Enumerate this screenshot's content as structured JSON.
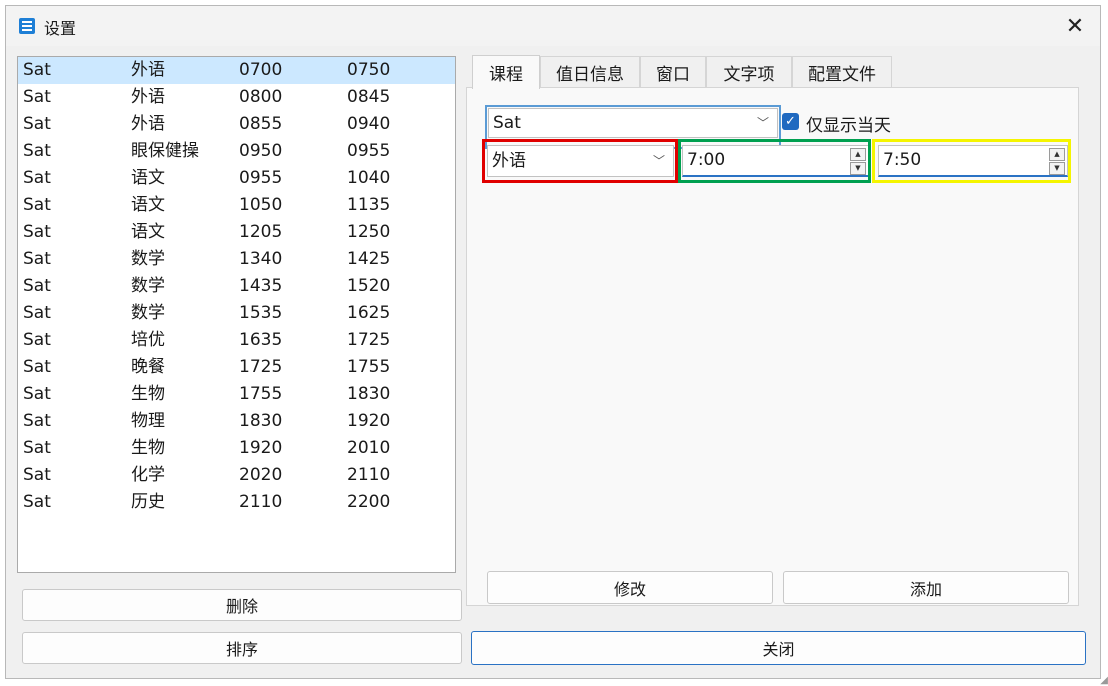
{
  "window": {
    "title": "设置",
    "close_glyph": "✕",
    "icon": "app-settings-icon"
  },
  "list": {
    "rows": [
      [
        "Sat",
        "外语",
        "0700",
        "0750"
      ],
      [
        "Sat",
        "外语",
        "0800",
        "0845"
      ],
      [
        "Sat",
        "外语",
        "0855",
        "0940"
      ],
      [
        "Sat",
        "眼保健操",
        "0950",
        "0955"
      ],
      [
        "Sat",
        "语文",
        "0955",
        "1040"
      ],
      [
        "Sat",
        "语文",
        "1050",
        "1135"
      ],
      [
        "Sat",
        "语文",
        "1205",
        "1250"
      ],
      [
        "Sat",
        "数学",
        "1340",
        "1425"
      ],
      [
        "Sat",
        "数学",
        "1435",
        "1520"
      ],
      [
        "Sat",
        "数学",
        "1535",
        "1625"
      ],
      [
        "Sat",
        "培优",
        "1635",
        "1725"
      ],
      [
        "Sat",
        "晚餐",
        "1725",
        "1755"
      ],
      [
        "Sat",
        "生物",
        "1755",
        "1830"
      ],
      [
        "Sat",
        "物理",
        "1830",
        "1920"
      ],
      [
        "Sat",
        "生物",
        "1920",
        "2010"
      ],
      [
        "Sat",
        "化学",
        "2020",
        "2110"
      ],
      [
        "Sat",
        "历史",
        "2110",
        "2200"
      ]
    ],
    "selected_index": 0
  },
  "buttons": {
    "delete": "删除",
    "sort": "排序",
    "modify": "修改",
    "add": "添加",
    "close": "关闭"
  },
  "tabs": [
    {
      "label": "课程",
      "active": true
    },
    {
      "label": "值日信息",
      "active": false
    },
    {
      "label": "窗口",
      "active": false
    },
    {
      "label": "文字项",
      "active": false
    },
    {
      "label": "配置文件",
      "active": false
    }
  ],
  "course_tab": {
    "day_combo": "Sat",
    "only_today_label": "仅显示当天",
    "only_today_checked": true,
    "subject_combo": "外语",
    "start_time": "7:00",
    "end_time": "7:50"
  },
  "colors": {
    "highlight_day": "#5b9bd5",
    "highlight_subject": "#e00000",
    "highlight_start": "#00a050",
    "highlight_end": "#f5f500",
    "selected_row": "#cce8ff",
    "accent": "#1f69c0"
  }
}
